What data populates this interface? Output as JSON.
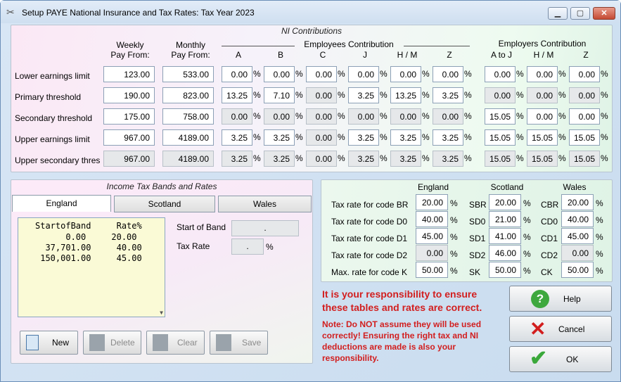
{
  "window": {
    "title": "Setup PAYE National Insurance and Tax Rates: Tax Year 2023",
    "min": "▭",
    "max": "▢",
    "close": "✕"
  },
  "ni": {
    "title": "NI Contributions",
    "weekly_l1": "Weekly",
    "weekly_l2": "Pay From:",
    "monthly_l1": "Monthly",
    "monthly_l2": "Pay From:",
    "emp_contrib": "Employees Contribution",
    "er_contrib": "Employers Contribution",
    "col_a": "A",
    "col_b": "B",
    "col_c": "C",
    "col_j": "J",
    "col_hm": "H / M",
    "col_z": "Z",
    "col_atoj": "A to J",
    "col_hm2": "H / M",
    "col_z2": "Z",
    "rows": [
      {
        "label": "Lower earnings limit",
        "weekly": "123.00",
        "monthly": "533.00",
        "A": "0.00",
        "B": "0.00",
        "C": "0.00",
        "J": "0.00",
        "HM": "0.00",
        "Z": "0.00",
        "eAJ": "0.00",
        "eHM": "0.00",
        "eZ": "0.00"
      },
      {
        "label": "Primary threshold",
        "weekly": "190.00",
        "monthly": "823.00",
        "A": "13.25",
        "B": "7.10",
        "C": "0.00",
        "J": "3.25",
        "HM": "13.25",
        "Z": "3.25",
        "eAJ": "0.00",
        "eHM": "0.00",
        "eZ": "0.00"
      },
      {
        "label": "Secondary threshold",
        "weekly": "175.00",
        "monthly": "758.00",
        "A": "0.00",
        "B": "0.00",
        "C": "0.00",
        "J": "0.00",
        "HM": "0.00",
        "Z": "0.00",
        "eAJ": "15.05",
        "eHM": "0.00",
        "eZ": "0.00"
      },
      {
        "label": "Upper earnings limit",
        "weekly": "967.00",
        "monthly": "4189.00",
        "A": "3.25",
        "B": "3.25",
        "C": "0.00",
        "J": "3.25",
        "HM": "3.25",
        "Z": "3.25",
        "eAJ": "15.05",
        "eHM": "15.05",
        "eZ": "15.05"
      },
      {
        "label": "Upper secondary thres",
        "weekly": "967.00",
        "monthly": "4189.00",
        "A": "3.25",
        "B": "3.25",
        "C": "0.00",
        "J": "3.25",
        "HM": "3.25",
        "Z": "3.25",
        "eAJ": "15.05",
        "eHM": "15.05",
        "eZ": "15.05"
      }
    ],
    "pct": "%"
  },
  "tax": {
    "title": "Income Tax Bands and Rates",
    "tabs": [
      "England",
      "Scotland",
      "Wales"
    ],
    "list_header": "StartofBand     Rate%",
    "list_rows": [
      "      0.00     20.00",
      "  37,701.00     40.00",
      " 150,001.00     45.00"
    ],
    "start_label": "Start of Band",
    "start_value": ".",
    "rate_label": "Tax Rate",
    "rate_value": ".",
    "pct": "%",
    "new": "New",
    "delete": "Delete",
    "clear": "Clear",
    "save": "Save"
  },
  "rates": {
    "england": "England",
    "scotland": "Scotland",
    "wales": "Wales",
    "rows": [
      {
        "label": "Tax rate for code BR",
        "eng": "20.00",
        "sc": "SBR",
        "scv": "20.00",
        "wc": "CBR",
        "wv": "20.00"
      },
      {
        "label": "Tax rate for code D0",
        "eng": "40.00",
        "sc": "SD0",
        "scv": "21.00",
        "wc": "CD0",
        "wv": "40.00"
      },
      {
        "label": "Tax rate for code D1",
        "eng": "45.00",
        "sc": "SD1",
        "scv": "41.00",
        "wc": "CD1",
        "wv": "45.00"
      },
      {
        "label": "Tax rate for code D2",
        "eng": "0.00",
        "sc": "SD2",
        "scv": "46.00",
        "wc": "CD2",
        "wv": "0.00"
      },
      {
        "label": "Max. rate for code K",
        "eng": "50.00",
        "sc": "SK",
        "scv": "50.00",
        "wc": "CK",
        "wv": "50.00"
      }
    ],
    "pct": "%"
  },
  "warning": {
    "main": "It is your responsibility to ensure these tables and rates are correct.",
    "note": "Note: Do NOT assume they will be used correctly!  Ensuring the right tax and NI deductions are made is also your responsibility."
  },
  "actions": {
    "help": "Help",
    "cancel": "Cancel",
    "ok": "OK"
  }
}
